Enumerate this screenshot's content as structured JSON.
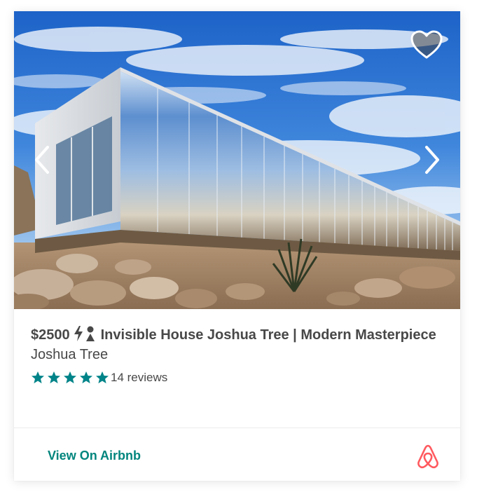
{
  "listing": {
    "price": "$2500",
    "title": "Invisible House Joshua Tree | Modern Masterpiece",
    "location": "Joshua Tree",
    "rating_stars": 5,
    "reviews": "14 reviews"
  },
  "footer": {
    "link_label": "View On Airbnb"
  },
  "icons": {
    "favorite": "heart-icon",
    "prev": "chevron-left-icon",
    "next": "chevron-right-icon",
    "instant_book": "instant-book-icon",
    "brand": "airbnb-logo-icon"
  },
  "colors": {
    "text": "#484848",
    "accent": "#00857d",
    "star": "#008489",
    "brand": "#ff5a5f"
  }
}
